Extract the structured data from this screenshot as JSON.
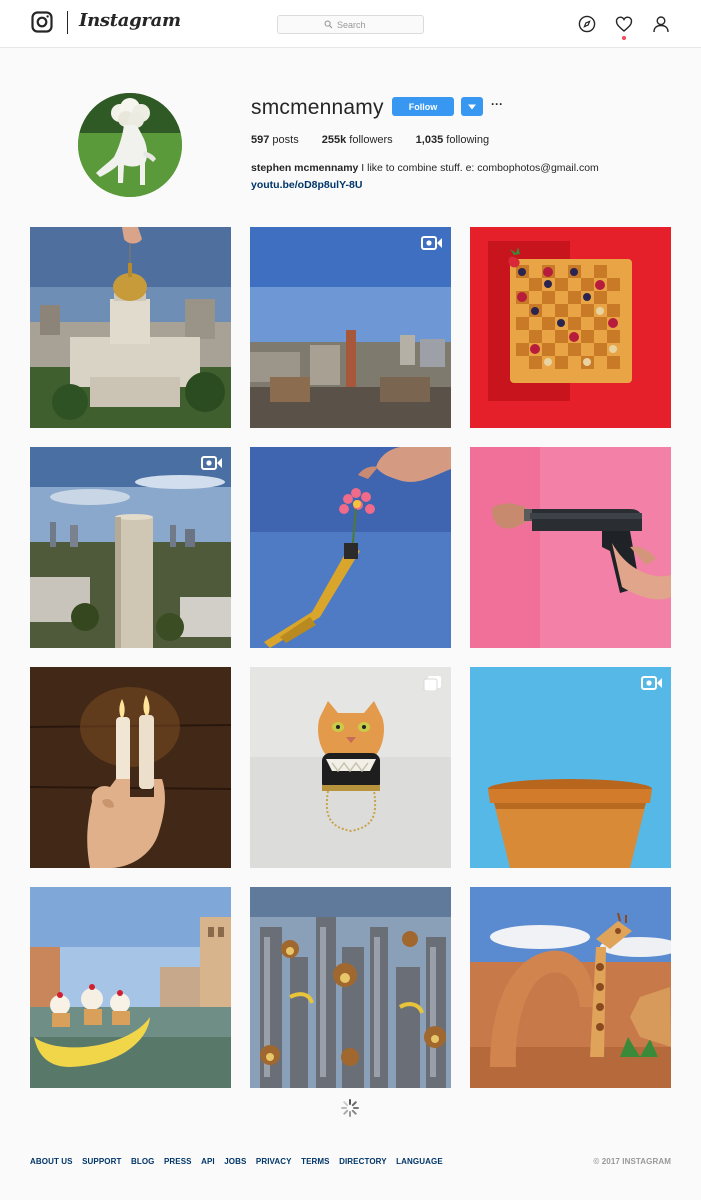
{
  "nav": {
    "brand": "Instagram",
    "search_placeholder": "Search"
  },
  "profile": {
    "username": "smcmennamy",
    "follow_label": "Follow",
    "more_label": "···",
    "stats": [
      {
        "count": "597",
        "label": "posts"
      },
      {
        "count": "255k",
        "label": "followers"
      },
      {
        "count": "1,035",
        "label": "following"
      }
    ],
    "bio_name": "stephen mcmennamy",
    "bio_text": "I like to combine stuff. e: combophotos@gmail.com",
    "link": "youtu.be/oD8p8ulY-8U"
  },
  "posts": [
    {
      "subject": "capitol-dome-pendant",
      "badge": "none"
    },
    {
      "subject": "city-smokestack",
      "badge": "video"
    },
    {
      "subject": "waffle-chessboard",
      "badge": "none"
    },
    {
      "subject": "water-tower-skyline",
      "badge": "video"
    },
    {
      "subject": "excavator-flower",
      "badge": "none"
    },
    {
      "subject": "stapler-gun",
      "badge": "none"
    },
    {
      "subject": "finger-candles",
      "badge": "none"
    },
    {
      "subject": "cat-purse",
      "badge": "carousel"
    },
    {
      "subject": "flower-pot",
      "badge": "video"
    },
    {
      "subject": "banana-boat-venice",
      "badge": "none"
    },
    {
      "subject": "monkey-city",
      "badge": "none"
    },
    {
      "subject": "giraffe-arch",
      "badge": "none"
    }
  ],
  "footer": {
    "links": [
      "ABOUT US",
      "SUPPORT",
      "BLOG",
      "PRESS",
      "API",
      "JOBS",
      "PRIVACY",
      "TERMS",
      "DIRECTORY",
      "LANGUAGE"
    ],
    "copyright": "© 2017 INSTAGRAM"
  },
  "colors": {
    "accent": "#3897f0",
    "link": "#003569",
    "notification": "#ed4956"
  }
}
